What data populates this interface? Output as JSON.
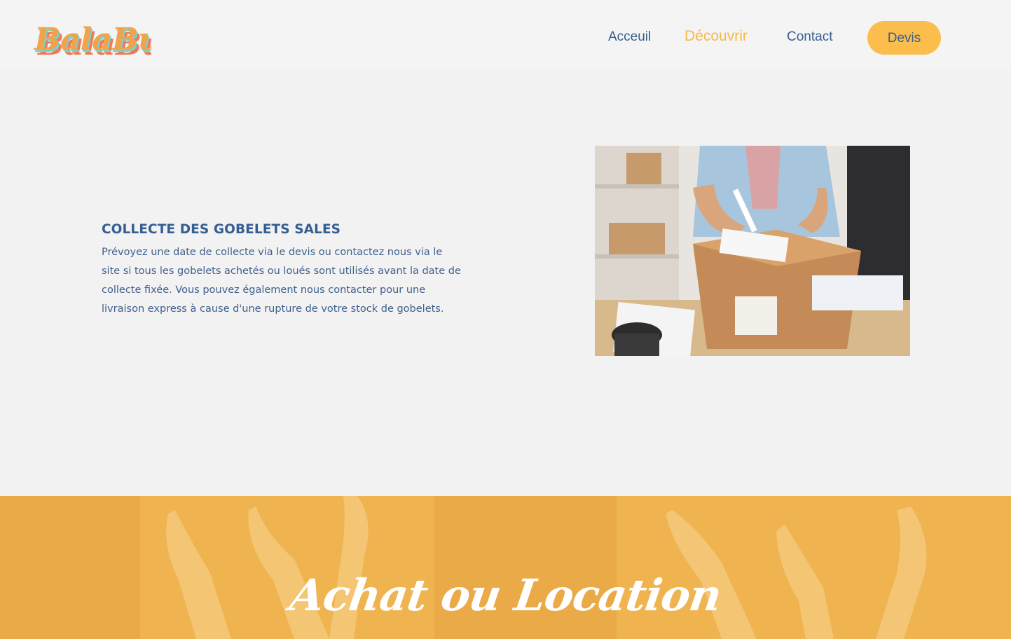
{
  "header": {
    "logo_text": "BalaBulle",
    "nav": [
      {
        "label": "Acceuil",
        "active": false
      },
      {
        "label": "Découvrir",
        "active": true
      },
      {
        "label": "Contact",
        "active": false
      }
    ],
    "devis_label": "Devis"
  },
  "section": {
    "title": "COLLECTE DES GOBELETS SALES",
    "text": "Prévoyez une date de collecte via le devis ou contactez nous via le site si tous les gobelets achetés ou loués sont utilisés avant la date de collecte fixée. Vous pouvez également nous contacter pour une livraison express à cause d'une rupture de votre stock de gobelets."
  },
  "banner": {
    "title": "Achat ou Location"
  },
  "colors": {
    "accent": "#fbbd4c",
    "primary_text": "#355e92",
    "background": "#f2f2f2"
  }
}
